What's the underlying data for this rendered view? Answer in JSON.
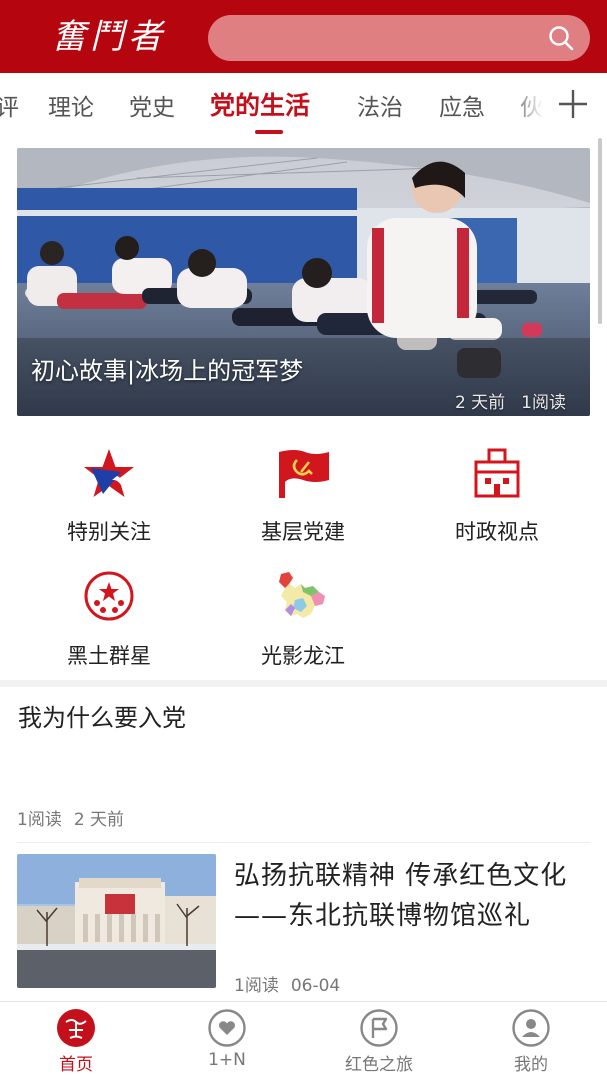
{
  "header": {
    "logo_text": "奮鬥者",
    "search": {
      "placeholder": ""
    }
  },
  "tabs": [
    {
      "label": "评",
      "active": false
    },
    {
      "label": "理论",
      "active": false
    },
    {
      "label": "党史",
      "active": false
    },
    {
      "label": "党的生活",
      "active": true
    },
    {
      "label": "法治",
      "active": false
    },
    {
      "label": "应急",
      "active": false
    },
    {
      "label": "伙",
      "active": false
    }
  ],
  "banner": {
    "title": "初心故事|冰场上的冠军梦",
    "time": "2 天前",
    "reads": "1阅读"
  },
  "grid": [
    {
      "label": "特别关注",
      "icon": "star-icon"
    },
    {
      "label": "基层党建",
      "icon": "party-flag-icon"
    },
    {
      "label": "时政视点",
      "icon": "building-icon"
    },
    {
      "label": "黑土群星",
      "icon": "stars-circle-icon"
    },
    {
      "label": "光影龙江",
      "icon": "heilongjiang-map-icon"
    }
  ],
  "articles": [
    {
      "title": "我为什么要入党",
      "reads": "1阅读",
      "time": "2 天前"
    },
    {
      "title": "弘扬抗联精神  传承红色文化——东北抗联博物馆巡礼",
      "reads": "1阅读",
      "time": "06-04"
    }
  ],
  "bottom_nav": [
    {
      "label": "首页",
      "icon": "home-logo-icon",
      "active": true
    },
    {
      "label": "1+N",
      "icon": "heart-icon",
      "active": false
    },
    {
      "label": "红色之旅",
      "icon": "flag-icon",
      "active": false
    },
    {
      "label": "我的",
      "icon": "user-icon",
      "active": false
    }
  ],
  "colors": {
    "brand": "#b5060f",
    "accent": "#c3101a",
    "search_bg": "#df7f82"
  }
}
